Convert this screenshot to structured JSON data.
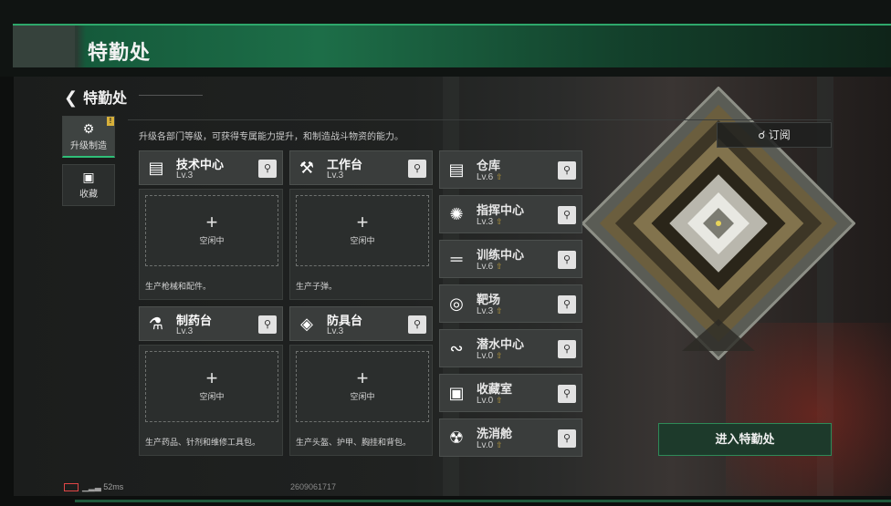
{
  "page_title": "特勤处",
  "header": {
    "back_title": "特勤处"
  },
  "description": "升级各部门等级，可获得专属能力提升，和制造战斗物资的能力。",
  "side_tabs": [
    {
      "label": "升级制造",
      "badge": "!",
      "icon": "upgrade-icon"
    },
    {
      "label": "收藏",
      "icon": "collection-icon"
    }
  ],
  "subscribe_label": "订阅",
  "main_cards": [
    {
      "name": "技术中心",
      "level": "Lv.3",
      "slot_label": "空闲中",
      "description": "生产枪械和配件。",
      "icon": "tech-icon"
    },
    {
      "name": "工作台",
      "level": "Lv.3",
      "slot_label": "空闲中",
      "description": "生产子弹。",
      "icon": "tools-icon"
    },
    {
      "name": "制药台",
      "level": "Lv.3",
      "slot_label": "空闲中",
      "description": "生产药品、针剂和维修工具包。",
      "icon": "microscope-icon"
    },
    {
      "name": "防具台",
      "level": "Lv.3",
      "slot_label": "空闲中",
      "description": "生产头盔、护甲、胸挂和背包。",
      "icon": "armor-icon"
    }
  ],
  "side_cards": [
    {
      "name": "仓库",
      "level": "Lv.6",
      "icon": "warehouse-icon"
    },
    {
      "name": "指挥中心",
      "level": "Lv.3",
      "icon": "command-icon"
    },
    {
      "name": "训练中心",
      "level": "Lv.6",
      "icon": "dumbbell-icon"
    },
    {
      "name": "靶场",
      "level": "Lv.3",
      "icon": "target-icon"
    },
    {
      "name": "潜水中心",
      "level": "Lv.0",
      "icon": "diving-icon"
    },
    {
      "name": "收藏室",
      "level": "Lv.0",
      "icon": "collection-room-icon"
    },
    {
      "name": "洗消舱",
      "level": "Lv.0",
      "icon": "decon-icon"
    }
  ],
  "enter_button": "进入特勤处",
  "status": {
    "ping": "52ms",
    "uid": "2609061717"
  },
  "colors": {
    "accent": "#2fbf78",
    "title_green": "#1d6e48",
    "card_bg": "#3a3d3c"
  }
}
